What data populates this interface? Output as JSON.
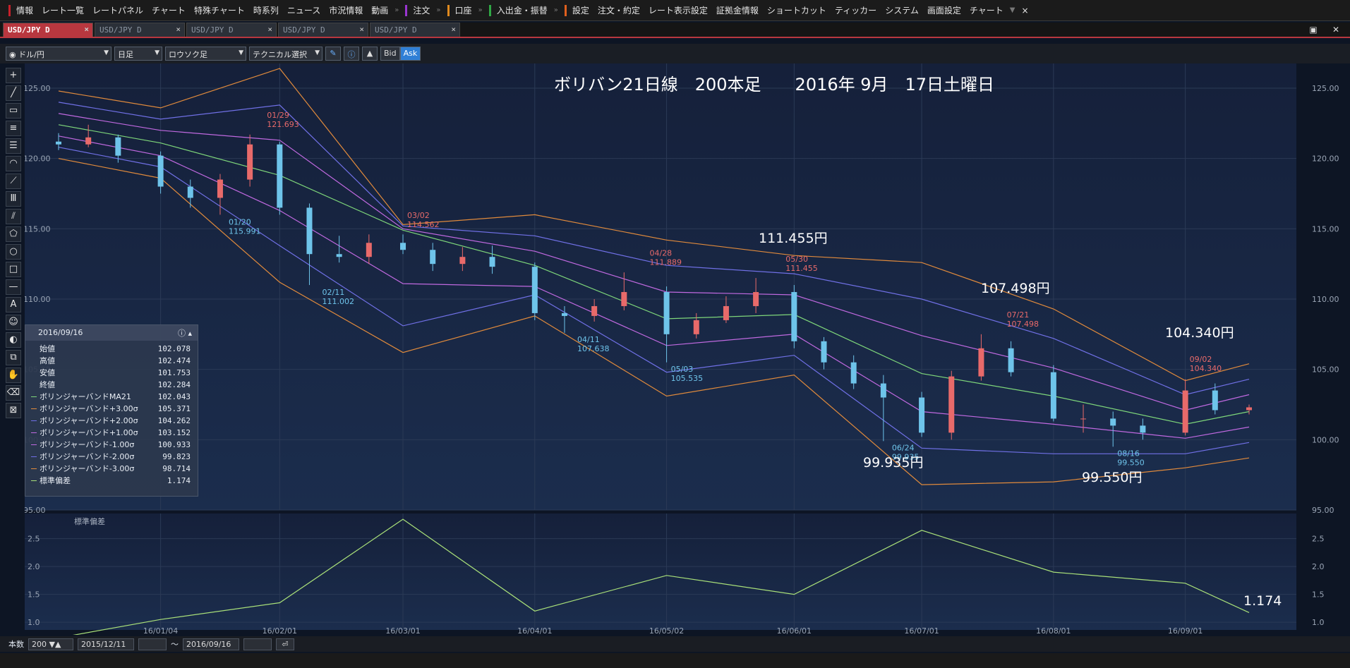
{
  "topbar": {
    "items": [
      "情報",
      "レート一覧",
      "レートパネル",
      "チャート",
      "特殊チャート",
      "時系列",
      "ニュース",
      "市況情報",
      "動画"
    ],
    "trade_items": [
      "注文",
      "口座",
      "入出金・振替"
    ],
    "settings_items": [
      "設定",
      "注文・約定",
      "レート表示設定",
      "証拠金情報",
      "ショートカット",
      "ティッカー",
      "システム",
      "画面設定",
      "チャート"
    ],
    "close_glyph": "×"
  },
  "tabs": [
    {
      "label": "USD/JPY D",
      "active": true
    },
    {
      "label": "USD/JPY D",
      "active": false
    },
    {
      "label": "USD/JPY D",
      "active": false
    },
    {
      "label": "USD/JPY D",
      "active": false
    },
    {
      "label": "USD/JPY D",
      "active": false
    }
  ],
  "toolbar": {
    "pair": "ドル/円",
    "period": "日足",
    "chart_type": "ロウソク足",
    "technical": "テクニカル選択",
    "bid": "Bid",
    "ask": "Ask"
  },
  "chart_data": {
    "type": "line",
    "title": "ボリバン21日線　200本足　　2016年 9月　17日土曜日",
    "main_yticks": [
      "125.00",
      "120.00",
      "115.00",
      "110.00",
      "105.00",
      "100.00",
      "95.00"
    ],
    "ylim": [
      95,
      125
    ],
    "sub_yticks": [
      "2.5",
      "2.0",
      "1.5",
      "1.0"
    ],
    "sub_ylim": [
      0.9,
      2.8
    ],
    "sub_label": "標準偏差",
    "x_ticks": [
      "16/01/04",
      "16/02/01",
      "16/03/01",
      "16/04/01",
      "16/05/02",
      "16/06/01",
      "16/07/01",
      "16/08/01",
      "16/09/01"
    ],
    "series": [
      {
        "name": "ボリンジャーバンドMA21",
        "color": "#7ed67a",
        "x": [
          "15/12/11",
          "16/01/04",
          "16/02/01",
          "16/03/01",
          "16/04/01",
          "16/05/02",
          "16/06/01",
          "16/07/01",
          "16/08/01",
          "16/09/01",
          "16/09/16"
        ],
        "values": [
          122.4,
          121.1,
          118.8,
          114.9,
          112.4,
          108.6,
          108.9,
          104.7,
          103.1,
          101.1,
          102.0
        ]
      },
      {
        "name": "ボリンジャーバンド+3.00σ",
        "color": "#e08a3c",
        "x": [
          "15/12/11",
          "16/01/04",
          "16/02/01",
          "16/03/01",
          "16/04/01",
          "16/05/02",
          "16/06/01",
          "16/07/01",
          "16/08/01",
          "16/09/01",
          "16/09/16"
        ],
        "values": [
          124.8,
          123.6,
          126.4,
          115.3,
          116.0,
          114.2,
          113.1,
          112.6,
          109.3,
          104.2,
          105.4
        ]
      },
      {
        "name": "ボリンジャーバンド+2.00σ",
        "color": "#7070e6",
        "x": [
          "15/12/11",
          "16/01/04",
          "16/02/01",
          "16/03/01",
          "16/04/01",
          "16/05/02",
          "16/06/01",
          "16/07/01",
          "16/08/01",
          "16/09/01",
          "16/09/16"
        ],
        "values": [
          124.0,
          122.8,
          123.8,
          115.2,
          114.5,
          112.4,
          111.8,
          110.0,
          107.2,
          103.2,
          104.3
        ]
      },
      {
        "name": "ボリンジャーバンド+1.00σ",
        "color": "#c069e0",
        "x": [
          "15/12/11",
          "16/01/04",
          "16/02/01",
          "16/03/01",
          "16/04/01",
          "16/05/02",
          "16/06/01",
          "16/07/01",
          "16/08/01",
          "16/09/01",
          "16/09/16"
        ],
        "values": [
          123.2,
          122.0,
          121.3,
          115.0,
          113.4,
          110.5,
          110.3,
          107.4,
          105.1,
          102.1,
          103.2
        ]
      },
      {
        "name": "ボリンジャーバンド-1.00σ",
        "color": "#c069e0",
        "x": [
          "15/12/11",
          "16/01/04",
          "16/02/01",
          "16/03/01",
          "16/04/01",
          "16/05/02",
          "16/06/01",
          "16/07/01",
          "16/08/01",
          "16/09/01",
          "16/09/16"
        ],
        "values": [
          121.6,
          120.2,
          116.3,
          111.1,
          110.9,
          106.7,
          107.5,
          102.0,
          101.1,
          100.1,
          100.9
        ]
      },
      {
        "name": "ボリンジャーバンド-2.00σ",
        "color": "#7070e6",
        "x": [
          "15/12/11",
          "16/01/04",
          "16/02/01",
          "16/03/01",
          "16/04/01",
          "16/05/02",
          "16/06/01",
          "16/07/01",
          "16/08/01",
          "16/09/01",
          "16/09/16"
        ],
        "values": [
          120.8,
          119.4,
          113.8,
          108.1,
          110.3,
          104.8,
          106.0,
          99.4,
          99.0,
          99.0,
          99.8
        ]
      },
      {
        "name": "ボリンジャーバンド-3.00σ",
        "color": "#e08a3c",
        "x": [
          "15/12/11",
          "16/01/04",
          "16/02/01",
          "16/03/01",
          "16/04/01",
          "16/05/02",
          "16/06/01",
          "16/07/01",
          "16/08/01",
          "16/09/01",
          "16/09/16"
        ],
        "values": [
          120.0,
          118.6,
          111.2,
          106.2,
          108.8,
          103.1,
          104.6,
          96.8,
          97.0,
          98.0,
          98.7
        ]
      },
      {
        "name": "標準偏差",
        "color": "#a9e079",
        "panel": "sub",
        "x": [
          "15/12/11",
          "16/01/04",
          "16/02/01",
          "16/03/01",
          "16/04/01",
          "16/05/02",
          "16/06/01",
          "16/07/01",
          "16/08/01",
          "16/09/01",
          "16/09/16"
        ],
        "values": [
          0.72,
          1.05,
          1.35,
          2.85,
          1.2,
          1.84,
          1.5,
          2.65,
          1.9,
          1.7,
          1.174
        ]
      }
    ],
    "candles": {
      "dates": [
        "15/12/11",
        "15/12/18",
        "15/12/25",
        "16/01/04",
        "16/01/11",
        "16/01/18",
        "16/01/25",
        "16/02/01",
        "16/02/08",
        "16/02/15",
        "16/02/22",
        "16/03/01",
        "16/03/08",
        "16/03/15",
        "16/03/22",
        "16/04/01",
        "16/04/08",
        "16/04/15",
        "16/04/22",
        "16/05/02",
        "16/05/09",
        "16/05/16",
        "16/05/23",
        "16/06/01",
        "16/06/08",
        "16/06/15",
        "16/06/22",
        "16/07/01",
        "16/07/08",
        "16/07/15",
        "16/07/22",
        "16/08/01",
        "16/08/08",
        "16/08/15",
        "16/08/22",
        "16/09/01",
        "16/09/08",
        "16/09/16"
      ],
      "open": [
        121.2,
        121.0,
        121.5,
        120.2,
        118.0,
        117.2,
        118.5,
        121.0,
        116.5,
        113.2,
        113.0,
        114.0,
        113.5,
        112.5,
        113.0,
        112.3,
        109.0,
        108.8,
        109.5,
        110.5,
        107.5,
        108.5,
        109.5,
        110.5,
        107.0,
        105.5,
        104.0,
        103.0,
        100.5,
        104.5,
        106.5,
        104.8,
        101.5,
        101.5,
        101.0,
        100.5,
        103.5,
        102.1
      ],
      "close": [
        121.0,
        121.5,
        120.2,
        118.0,
        117.2,
        118.5,
        121.0,
        116.5,
        113.2,
        113.0,
        114.0,
        113.5,
        112.5,
        113.0,
        112.3,
        109.0,
        108.8,
        109.5,
        110.5,
        107.5,
        108.5,
        109.5,
        110.5,
        107.0,
        105.5,
        104.0,
        103.0,
        100.5,
        104.5,
        106.5,
        104.8,
        101.5,
        101.5,
        101.0,
        100.5,
        103.5,
        102.1,
        102.3
      ],
      "high": [
        121.8,
        122.4,
        121.7,
        120.5,
        118.5,
        118.9,
        121.7,
        121.2,
        116.8,
        114.5,
        114.6,
        114.6,
        114.0,
        113.7,
        113.8,
        112.6,
        109.5,
        110.0,
        111.9,
        110.9,
        109.0,
        110.2,
        111.5,
        111.0,
        107.3,
        106.0,
        104.6,
        103.4,
        104.9,
        107.5,
        107.0,
        105.3,
        102.5,
        102.0,
        101.5,
        104.3,
        104.0,
        102.5
      ],
      "low": [
        120.6,
        120.8,
        119.7,
        117.5,
        116.5,
        116.0,
        118.0,
        116.0,
        111.0,
        112.6,
        112.5,
        113.2,
        112.0,
        112.0,
        111.8,
        108.5,
        107.6,
        108.4,
        109.2,
        105.5,
        107.2,
        108.3,
        109.0,
        106.5,
        105.0,
        103.6,
        99.9,
        100.2,
        100.0,
        104.2,
        104.5,
        101.3,
        100.5,
        99.5,
        100.0,
        100.3,
        101.8,
        101.8
      ]
    },
    "annotations": [
      {
        "date": "01/29",
        "value": "121.693",
        "kind": "high"
      },
      {
        "date": "01/20",
        "value": "115.991",
        "kind": "low"
      },
      {
        "date": "02/11",
        "value": "111.002",
        "kind": "low"
      },
      {
        "date": "03/02",
        "value": "114.562",
        "kind": "high"
      },
      {
        "date": "04/11",
        "value": "107.638",
        "kind": "low"
      },
      {
        "date": "04/28",
        "value": "111.889",
        "kind": "high"
      },
      {
        "date": "05/03",
        "value": "105.535",
        "kind": "low"
      },
      {
        "date": "05/30",
        "value": "111.455",
        "kind": "high"
      },
      {
        "date": "06/24",
        "value": "99.935",
        "kind": "low"
      },
      {
        "date": "07/21",
        "value": "107.498",
        "kind": "high"
      },
      {
        "date": "08/16",
        "value": "99.550",
        "kind": "low"
      },
      {
        "date": "09/02",
        "value": "104.340",
        "kind": "high"
      }
    ],
    "callouts": [
      "111.455円",
      "107.498円",
      "104.340円",
      "99.935円",
      "99.550円"
    ],
    "sub_callout": "1.174"
  },
  "infobox": {
    "date": "2016/09/16",
    "rows": [
      {
        "label": "始値",
        "value": "102.078",
        "color": ""
      },
      {
        "label": "高値",
        "value": "102.474",
        "color": ""
      },
      {
        "label": "安値",
        "value": "101.753",
        "color": ""
      },
      {
        "label": "終値",
        "value": "102.284",
        "color": ""
      },
      {
        "label": "ボリンジャーバンドMA21",
        "value": "102.043",
        "color": "#7ed67a"
      },
      {
        "label": "ボリンジャーバンド+3.00σ",
        "value": "105.371",
        "color": "#e08a3c"
      },
      {
        "label": "ボリンジャーバンド+2.00σ",
        "value": "104.262",
        "color": "#7070e6"
      },
      {
        "label": "ボリンジャーバンド+1.00σ",
        "value": "103.152",
        "color": "#c069e0"
      },
      {
        "label": "ボリンジャーバンド-1.00σ",
        "value": "100.933",
        "color": "#c069e0"
      },
      {
        "label": "ボリンジャーバンド-2.00σ",
        "value": "99.823",
        "color": "#7070e6"
      },
      {
        "label": "ボリンジャーバンド-3.00σ",
        "value": "98.714",
        "color": "#e08a3c"
      },
      {
        "label": "標準偏差",
        "value": "1.174",
        "color": "#a9e079"
      }
    ]
  },
  "bottombar": {
    "count_label": "本数",
    "count_value": "200",
    "from_date": "2015/12/11",
    "tilde": "～",
    "to_date": "2016/09/16"
  },
  "colors": {
    "up": "#e86a6a",
    "down": "#6ec4ea",
    "accent": "#b8373f"
  }
}
